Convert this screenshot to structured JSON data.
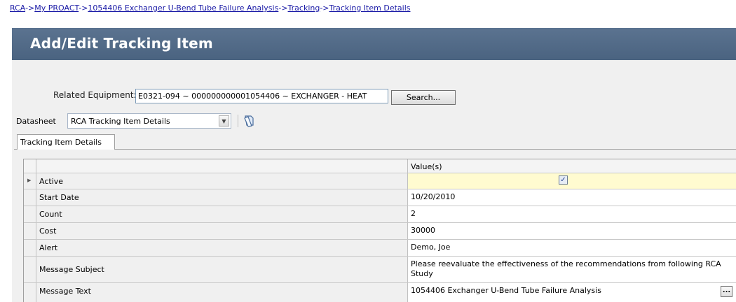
{
  "breadcrumb": [
    {
      "label": "RCA"
    },
    {
      "label": "My PROACT"
    },
    {
      "label": "1054406 Exchanger U-Bend Tube Failure Analysis"
    },
    {
      "label": "Tracking"
    },
    {
      "label": "Tracking Item Details"
    }
  ],
  "breadcrumb_separator": "->",
  "page_title": "Add/Edit Tracking Item",
  "related_equipment": {
    "label": "Related Equipment:",
    "value": "E0321-094 ~ 000000000001054406 ~ EXCHANGER - HEAT",
    "search_label": "Search..."
  },
  "datasheet": {
    "label": "Datasheet",
    "selected": "RCA Tracking Item Details",
    "icon": "datasheet-options-icon"
  },
  "tabs": [
    {
      "label": "Tracking Item Details"
    }
  ],
  "grid": {
    "value_header": "Value(s)",
    "rows": [
      {
        "field": "Active",
        "value": "",
        "checked": true
      },
      {
        "field": "Start Date",
        "value": "10/20/2010"
      },
      {
        "field": "Count",
        "value": "2"
      },
      {
        "field": "Cost",
        "value": "30000"
      },
      {
        "field": "Alert",
        "value": "Demo, Joe"
      },
      {
        "field": "Message Subject",
        "value": "Please reevaluate the effectiveness of the recommendations from following RCA Study"
      },
      {
        "field": "Message Text",
        "value": "1054406 Exchanger U-Bend Tube Failure Analysis"
      }
    ],
    "ellipsis_label": "..."
  },
  "colors": {
    "title_bar": "#4f6885",
    "active_row_highlight": "#fffbd0",
    "link": "#1a1aa6"
  }
}
